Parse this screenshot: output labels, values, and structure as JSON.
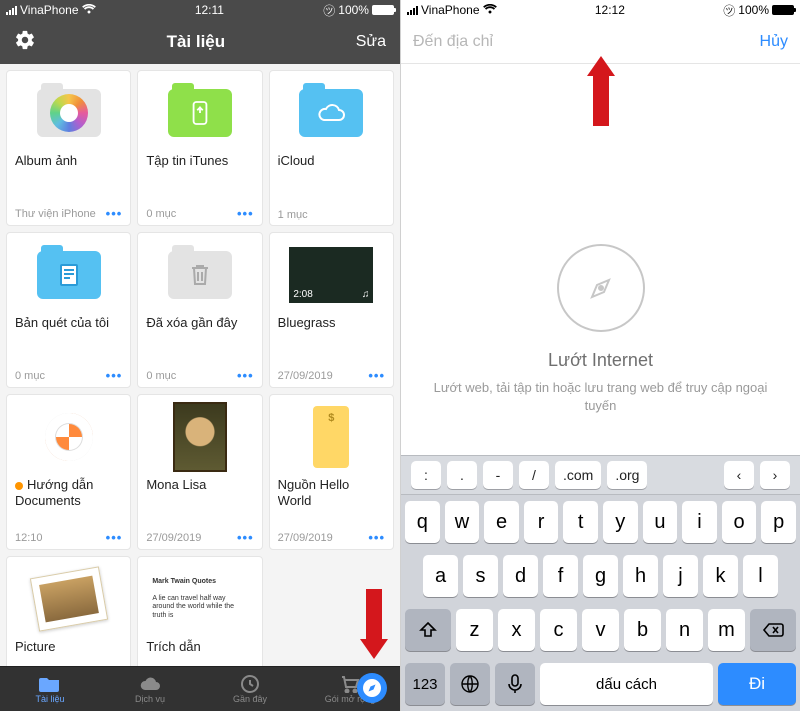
{
  "left": {
    "status": {
      "carrier": "VinaPhone",
      "time": "12:11",
      "battery": "100%"
    },
    "nav": {
      "title": "Tài liệu",
      "edit": "Sửa"
    },
    "cards": [
      {
        "title": "Album ảnh",
        "sub": "Thư viện iPhone"
      },
      {
        "title": "Tập tin iTunes",
        "sub": "0 mục"
      },
      {
        "title": "iCloud",
        "sub": "1 mục"
      },
      {
        "title": "Bản quét của tôi",
        "sub": "0 mục"
      },
      {
        "title": "Đã xóa gần đây",
        "sub": "0 mục"
      },
      {
        "title": "Bluegrass",
        "sub": "27/09/2019",
        "badge": "2:08"
      },
      {
        "title": "Hướng dẫn Documents",
        "sub": "12:10",
        "dot": true
      },
      {
        "title": "Mona Lisa",
        "sub": "27/09/2019"
      },
      {
        "title": "Nguồn Hello World",
        "sub": "27/09/2019"
      },
      {
        "title": "Picture",
        "sub": ""
      },
      {
        "title": "Trích dẫn",
        "sub": "",
        "quote_h": "Mark Twain Quotes",
        "quote_b": "A lie can travel half way around the world while the truth is"
      }
    ],
    "tabs": {
      "t1": "Tài liệu",
      "t2": "Dịch vụ",
      "t3": "Gần đây",
      "t4": "Gói mở rộng"
    }
  },
  "right": {
    "status": {
      "carrier": "VinaPhone",
      "time": "12:12",
      "battery": "100%"
    },
    "addr": {
      "placeholder": "Đến địa chỉ",
      "cancel": "Hủy"
    },
    "body": {
      "h": "Lướt Internet",
      "p": "Lướt web, tải tập tin hoặc lưu trang web để truy cập ngoại tuyến"
    },
    "kb": {
      "acc": {
        "k1": ":",
        "k2": ".",
        "k3": "-",
        "k4": "/",
        "k5": ".com",
        "k6": ".org"
      },
      "r1": [
        "q",
        "w",
        "e",
        "r",
        "t",
        "y",
        "u",
        "i",
        "o",
        "p"
      ],
      "r2": [
        "a",
        "s",
        "d",
        "f",
        "g",
        "h",
        "j",
        "k",
        "l"
      ],
      "r3": [
        "z",
        "x",
        "c",
        "v",
        "b",
        "n",
        "m"
      ],
      "r4": {
        "num": "123",
        "space": "dấu cách",
        "go": "Đi"
      }
    }
  }
}
